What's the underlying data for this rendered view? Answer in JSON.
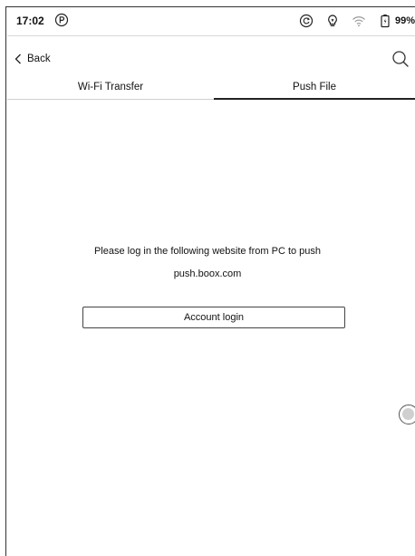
{
  "status_bar": {
    "time": "17:02",
    "battery_percent": "99%",
    "icons": [
      "p-circle-icon",
      "sync-icon",
      "lightbulb-icon",
      "wifi-icon",
      "battery-icon"
    ]
  },
  "header": {
    "back_label": "Back",
    "search_icon": "search-icon"
  },
  "tabs": [
    {
      "label": "Wi-Fi Transfer",
      "active": false
    },
    {
      "label": "Push File",
      "active": true
    }
  ],
  "main": {
    "instruction": "Please log in the following website from PC to push",
    "website": "push.boox.com",
    "login_button_label": "Account login"
  },
  "colors": {
    "text": "#111111",
    "background": "#ffffff",
    "active_tab_indicator": "#222222"
  }
}
